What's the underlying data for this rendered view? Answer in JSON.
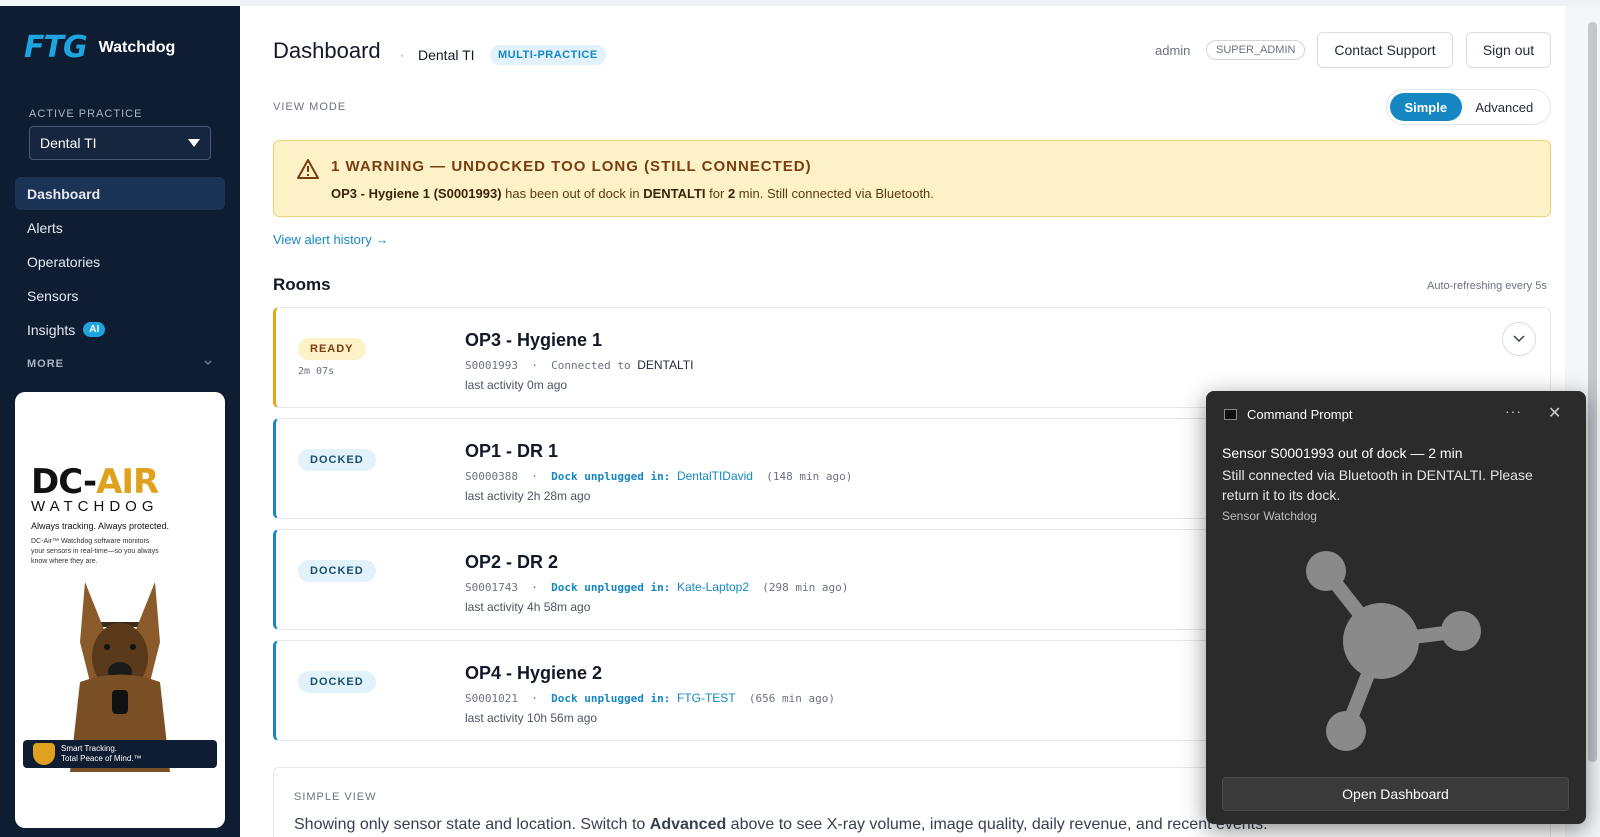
{
  "sidebar": {
    "logo": "FTG",
    "app_name": "Watchdog",
    "active_practice_label": "ACTIVE PRACTICE",
    "practice_value": "Dental TI",
    "nav": [
      {
        "label": "Dashboard",
        "active": true
      },
      {
        "label": "Alerts"
      },
      {
        "label": "Operatories"
      },
      {
        "label": "Sensors"
      },
      {
        "label": "Insights",
        "badge": "AI"
      }
    ],
    "more_label": "MORE",
    "ad": {
      "logo_main": "DC-",
      "logo_accent": "AIR",
      "logo_sub": "WATCHDOG",
      "tagline": "Always tracking. Always protected.",
      "description": "DC-Air™ Watchdog software monitors your sensors in real-time—so you always know where they are.",
      "footer_line1": "Smart Tracking.",
      "footer_line2": "Total Peace of Mind.™"
    }
  },
  "header": {
    "title": "Dashboard",
    "separator": "·",
    "practice": "Dental TI",
    "badge": "MULTI-PRACTICE",
    "user": "admin",
    "role": "SUPER_ADMIN",
    "contact_support": "Contact Support",
    "sign_out": "Sign out"
  },
  "view_mode": {
    "label": "VIEW MODE",
    "simple": "Simple",
    "advanced": "Advanced",
    "selected": "Simple"
  },
  "warning": {
    "title": "1 WARNING — UNDOCKED TOO LONG (STILL CONNECTED)",
    "sensor": "OP3 - Hygiene 1 (S0001993)",
    "text1": " has been out of dock in ",
    "location": "DENTALTI",
    "text2": " for ",
    "minutes": "2",
    "text3": " min. Still connected via Bluetooth.",
    "history_link": "View alert history →"
  },
  "rooms": {
    "title": "Rooms",
    "refresh": "Auto-refreshing every 5s",
    "items": [
      {
        "status": "READY",
        "duration": "2m 07s",
        "name": "OP3 - Hygiene 1",
        "sensor": "S0001993",
        "dot": "·",
        "connection_label": "Connected to",
        "location": "DENTALTI",
        "ago": "",
        "activity": "last activity 0m ago"
      },
      {
        "status": "DOCKED",
        "duration": "",
        "name": "OP1 - DR 1",
        "sensor": "S0000388",
        "dot": "·",
        "connection_label": "Dock unplugged in:",
        "location": "DentalTIDavid",
        "ago": "(148 min ago)",
        "activity": "last activity 2h 28m ago"
      },
      {
        "status": "DOCKED",
        "duration": "",
        "name": "OP2 - DR 2",
        "sensor": "S0001743",
        "dot": "·",
        "connection_label": "Dock unplugged in:",
        "location": "Kate-Laptop2",
        "ago": "(298 min ago)",
        "activity": "last activity 4h 58m ago"
      },
      {
        "status": "DOCKED",
        "duration": "",
        "name": "OP4 - Hygiene 2",
        "sensor": "S0001021",
        "dot": "·",
        "connection_label": "Dock unplugged in:",
        "location": "FTG-TEST",
        "ago": "(656 min ago)",
        "activity": "last activity 10h 56m ago"
      }
    ]
  },
  "simple_view": {
    "label": "SIMPLE VIEW",
    "text_before": "Showing only sensor state and location. Switch to ",
    "text_bold": "Advanced",
    "text_after": " above to see X-ray volume, image quality, daily revenue, and recent events."
  },
  "toast": {
    "app": "Command Prompt",
    "more": "···",
    "close": "✕",
    "title": "Sensor S0001993 out of dock — 2 min",
    "body": "Still connected via Bluetooth in DENTALTI. Please return it to its dock.",
    "source": "Sensor Watchdog",
    "button": "Open Dashboard"
  },
  "colors": {
    "sidebar_bg": "#0f1d33",
    "accent": "#1787c4",
    "warning_bg": "#fdf1c7",
    "ready_border": "#e8a51a"
  }
}
